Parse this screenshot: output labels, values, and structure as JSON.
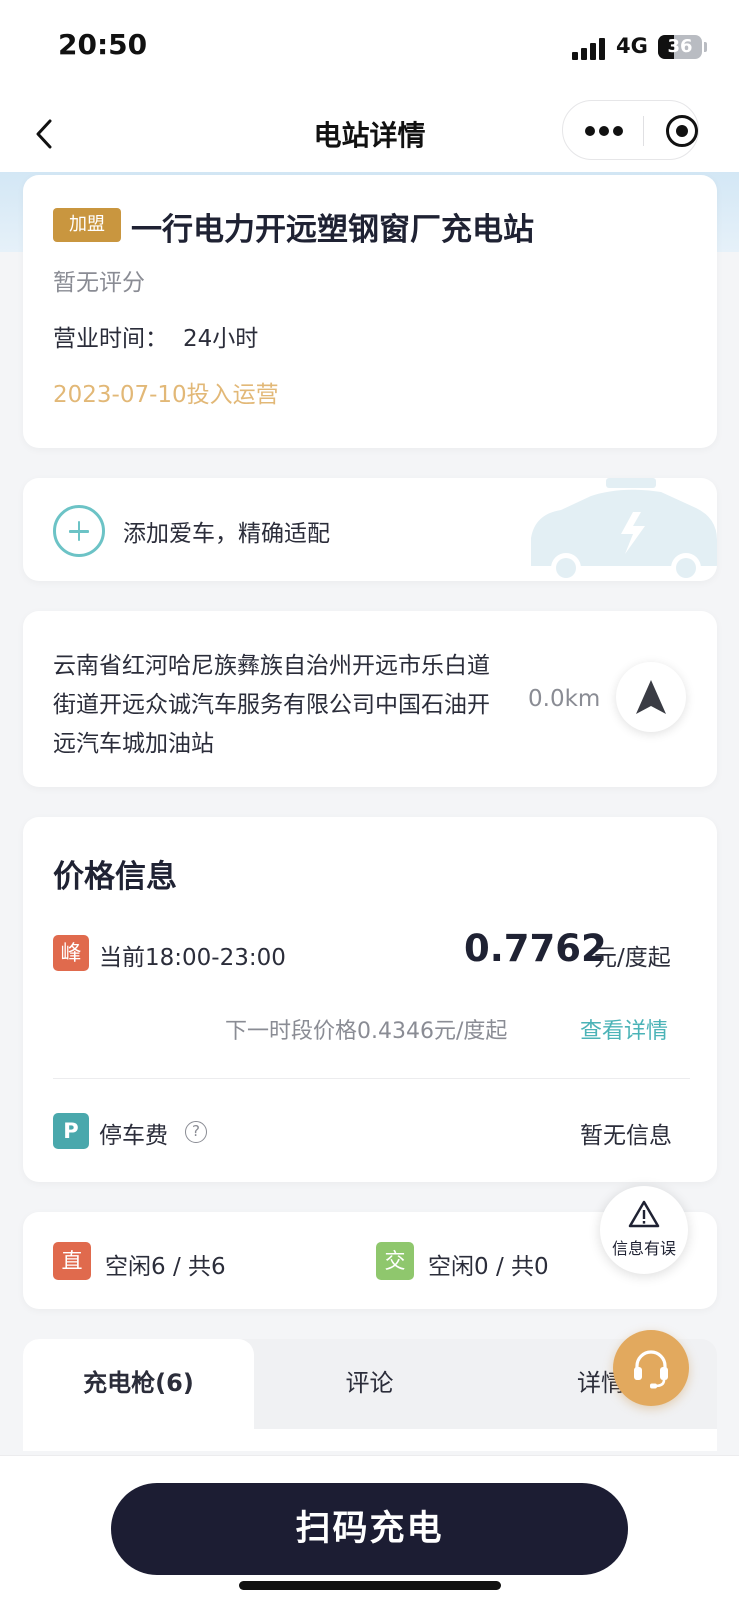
{
  "status_bar": {
    "time": "20:50",
    "network": "4G",
    "battery": "36",
    "battery_level": 0.36
  },
  "nav": {
    "title": "电站详情",
    "icons": [
      "back-arrow-icon",
      "more-dots-icon",
      "miniprogram-target-icon"
    ]
  },
  "station": {
    "tag": "加盟",
    "name": "一行电力开远塑钢窗厂充电站",
    "rating": "暂无评分",
    "hours_label": "营业时间：",
    "hours_value": "24小时",
    "open_date": "2023-07-10投入运营"
  },
  "car": {
    "add_label": "添加爱车，精确适配",
    "icons": [
      "plus-circle-icon",
      "electric-car-icon"
    ]
  },
  "address": {
    "text": "云南省红河哈尼族彝族自治州开远市乐白道街道开远众诚汽车服务有限公司中国石油开远汽车城加油站",
    "distance": "0.0km"
  },
  "price": {
    "title": "价格信息",
    "peak_badge": "峰",
    "period": "当前18:00-23:00",
    "value": "0.7762",
    "unit": "元/度起",
    "next_price": "下一时段价格0.4346元/度起",
    "view_detail": "查看详情",
    "parking_badge": "P",
    "parking_label": "停车费",
    "parking_value": "暂无信息"
  },
  "availability": {
    "dc_badge": "直",
    "dc_text": "空闲6 / 共6",
    "ac_badge": "交",
    "ac_text": "空闲0 / 共0"
  },
  "report": {
    "label": "信息有误"
  },
  "tabs": [
    "充电枪(6)",
    "评论",
    "详情"
  ],
  "bottom": {
    "scan_button": "扫码充电"
  },
  "colors": {
    "accent_teal": "#4bb3b7",
    "peak_red": "#e06a4d",
    "ac_green": "#8fc76d",
    "franchise_gold": "#c9963f",
    "date_gold": "#e2b877",
    "support_orange": "#e2a95e",
    "scan_button_bg": "#1c1d33"
  }
}
